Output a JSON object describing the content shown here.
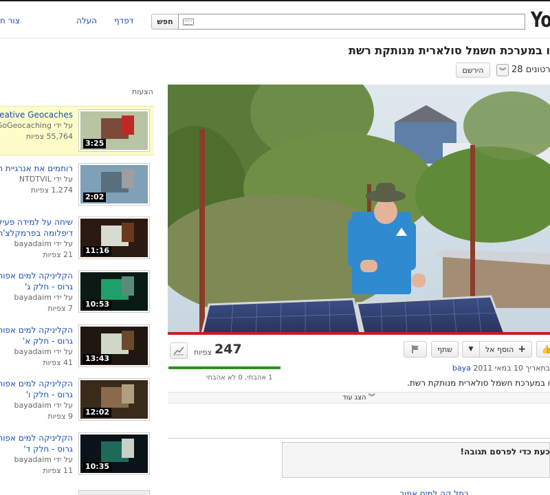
{
  "header": {
    "logo": "Yo",
    "links": {
      "create": "צור ח",
      "upload": "העלה",
      "browse": "דפדף"
    },
    "search_button": "חפש",
    "search_value": ""
  },
  "video": {
    "title": "ו במערכת חשמל סולארית מנותקת רשת",
    "subscribe": "הירשם",
    "video_count": "28 סרטונים",
    "views": "247",
    "views_label": "צפיות",
    "likes_text": "1 אהבתי, 0 לא אהבתי",
    "add_to": "הוסף אל",
    "share": "שתף",
    "upload_channel": "baya",
    "upload_date": "בתאריך 10 במאי 2011",
    "description": "ו במערכת חשמל סולארית מנותקת רשת.",
    "show_more": "הצג עוד",
    "comment_prompt": "כעת כדי לפרסם תגובה!",
    "progress": 1.0,
    "like_ratio": 1.0
  },
  "suggestions": {
    "header": "הצעות",
    "items": [
      {
        "title_lines": [
          "reative Geocaches"
        ],
        "by": "על ידי GoGeocaching",
        "views": "55,764 צפיות",
        "duration": "3:25",
        "highlighted": true
      },
      {
        "title_lines": [
          "רותמים את אנרגיית ה"
        ],
        "by": "על ידי NTDTVIL",
        "views": "1,274 צפיות",
        "duration": "2:02",
        "highlighted": false
      },
      {
        "title_lines": [
          "שיחה על למידה פעיל",
          "דיפלומה בפרמקלצ'ר"
        ],
        "by": "על ידי bayadaim",
        "views": "21 צפיות",
        "duration": "11:16",
        "highlighted": false
      },
      {
        "title_lines": [
          "הקליניקה למים אפור",
          "גרוס - חלק ג'"
        ],
        "by": "על ידי bayadaim",
        "views": "7 צפיות",
        "duration": "10:53",
        "highlighted": false
      },
      {
        "title_lines": [
          "הקליניקה למים אפור",
          "גרוס - חלק א'"
        ],
        "by": "על ידי bayadaim",
        "views": "41 צפיות",
        "duration": "13:43",
        "highlighted": false
      },
      {
        "title_lines": [
          "הקליניקה למים אפור",
          "גרוס - חלק ו'"
        ],
        "by": "על ידי bayadaim",
        "views": "9 צפיות",
        "duration": "12:02",
        "highlighted": false
      },
      {
        "title_lines": [
          "הקליניקה למים אפור",
          "גרוס - חלק ד'"
        ],
        "by": "על ידי bayadaim",
        "views": "11 צפיות",
        "duration": "10:35",
        "highlighted": false
      }
    ],
    "next_partial": "בתל קה למים אפור"
  },
  "colors": {
    "link": "#1a4db0",
    "progress": "#c91d1d",
    "like": "#2d8f1e",
    "highlight": "#fdfdc9"
  }
}
